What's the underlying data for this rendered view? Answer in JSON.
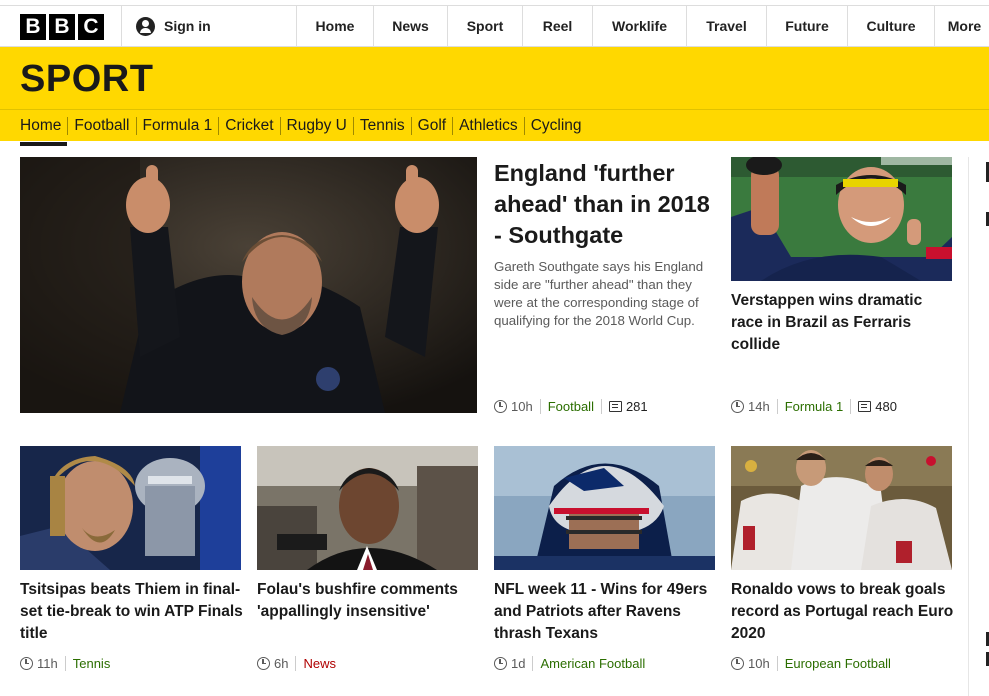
{
  "brand": {
    "logo_letters": [
      "B",
      "B",
      "C"
    ]
  },
  "account": {
    "signin_label": "Sign in"
  },
  "top_nav": [
    "Home",
    "News",
    "Sport",
    "Reel",
    "Worklife",
    "Travel",
    "Future",
    "Culture",
    "More"
  ],
  "sport": {
    "title": "SPORT",
    "nav": [
      "Home",
      "Football",
      "Formula 1",
      "Cricket",
      "Rugby U",
      "Tennis",
      "Golf",
      "Athletics",
      "Cycling"
    ],
    "active": "Home"
  },
  "hero": {
    "headline": "England 'further ahead' than in 2018 - Southgate",
    "summary": "Gareth Southgate says his England side are \"further ahead\" than they were at the corresponding stage of qualifying for the 2018 World Cup.",
    "age": "10h",
    "section": "Football",
    "comments": "281"
  },
  "side_story": {
    "headline": "Verstappen wins dramatic race in Brazil as Ferraris collide",
    "age": "14h",
    "section": "Formula 1",
    "comments": "480"
  },
  "cards": [
    {
      "headline": "Tsitsipas beats Thiem in final-set tie-break to win ATP Finals title",
      "age": "11h",
      "section": "Tennis"
    },
    {
      "headline": "Folau's bushfire comments 'appallingly insensitive'",
      "age": "6h",
      "section": "News"
    },
    {
      "headline": "NFL week 11 - Wins for 49ers and Patriots after Ravens thrash Texans",
      "age": "1d",
      "section": "American Football"
    },
    {
      "headline": "Ronaldo vows to break goals record as Portugal reach Euro 2020",
      "age": "10h",
      "section": "European Football"
    }
  ],
  "colors": {
    "sport_yellow": "#ffd800",
    "section_green": "#2b6e00"
  }
}
